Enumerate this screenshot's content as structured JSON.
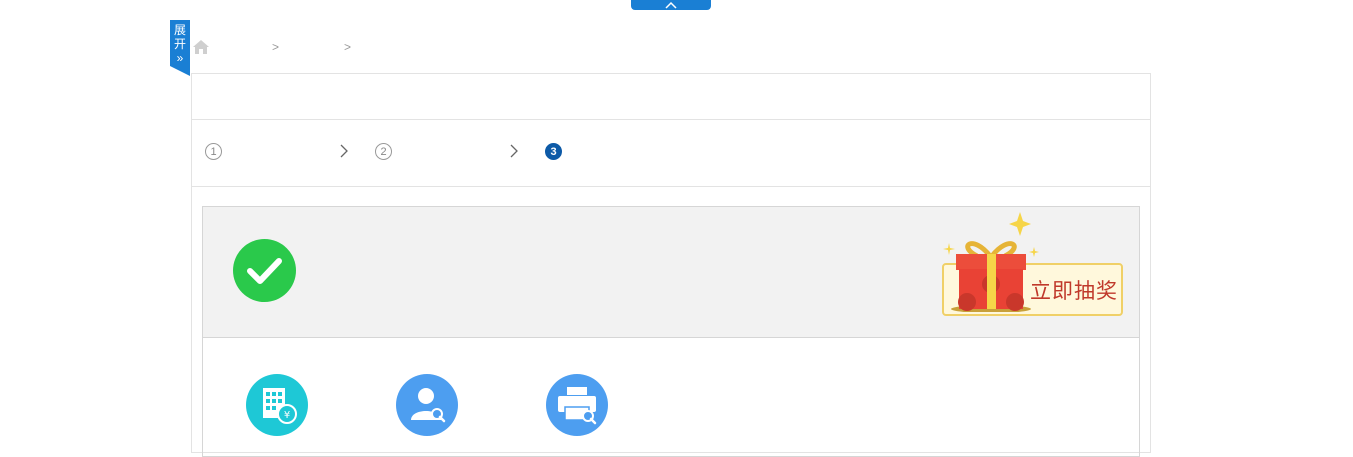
{
  "sidebar_tab": {
    "label_line1": "展",
    "label_line2": "开",
    "chevron": "»"
  },
  "breadcrumb": {
    "separator_1": ">",
    "separator_2": ">"
  },
  "steps": [
    {
      "number": "1"
    },
    {
      "number": "2"
    },
    {
      "number": "3",
      "active": true
    }
  ],
  "lottery": {
    "label": "立即抽奖"
  },
  "icons": {
    "top_toggle": "chevron-up-icon",
    "home": "home-icon",
    "success": "check-icon",
    "gift": "gift-icon",
    "action_1": "building-payment-icon",
    "action_2": "user-search-icon",
    "action_3": "printer-search-icon"
  },
  "colors": {
    "primary": "#1a7fd4",
    "step_active": "#0d5aa7",
    "success": "#2ac94b",
    "lottery_text": "#c0392b",
    "action_teal": "#1ec8d6",
    "action_blue": "#4d9ef0"
  }
}
